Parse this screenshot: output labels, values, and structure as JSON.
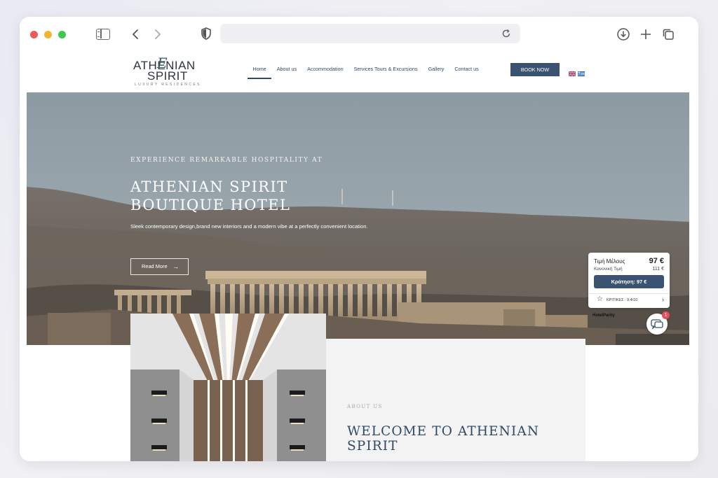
{
  "browser": {
    "address": ""
  },
  "header": {
    "logo_line1": "ATHENIAN",
    "logo_line2": "SPIRIT",
    "logo_sub": "LUXURY RESIDENCES",
    "logo_script": "E",
    "nav": [
      {
        "label": "Home",
        "active": true
      },
      {
        "label": "About us"
      },
      {
        "label": "Accommodation"
      },
      {
        "label": "Services Tours & Excursions"
      },
      {
        "label": "Gallery"
      },
      {
        "label": "Contact us"
      }
    ],
    "book_label": "BOOK NOW",
    "languages": [
      "English",
      "Greek"
    ]
  },
  "hero": {
    "kicker": "EXPERIENCE REMARKABLE HOSPITALITY AT",
    "title_line1": "ATHENIAN SPIRIT",
    "title_line2": "BOUTIQUE HOTEL",
    "description": "Sleek contemporary design,brand new interiors and a modern vibe at a perfectly convenient location.",
    "cta": "Read More"
  },
  "price_widget": {
    "member_label": "Τιμή Μέλους",
    "member_price": "97 €",
    "normal_label": "Κανονική Τιμή",
    "normal_price": "111 €",
    "button_label": "Κράτηση: 97 €",
    "reviews": "ΚΡΙΤΙΚΕΣ : 9.4/10",
    "brand": "HotelParity"
  },
  "chat": {
    "badge": "1"
  },
  "about": {
    "kicker": "ABOUT US",
    "title": "WELCOME TO ATHENIAN SPIRIT"
  },
  "colors": {
    "accent": "#3a5370",
    "nav_text": "#2f4a63",
    "badge": "#e94e5c"
  }
}
